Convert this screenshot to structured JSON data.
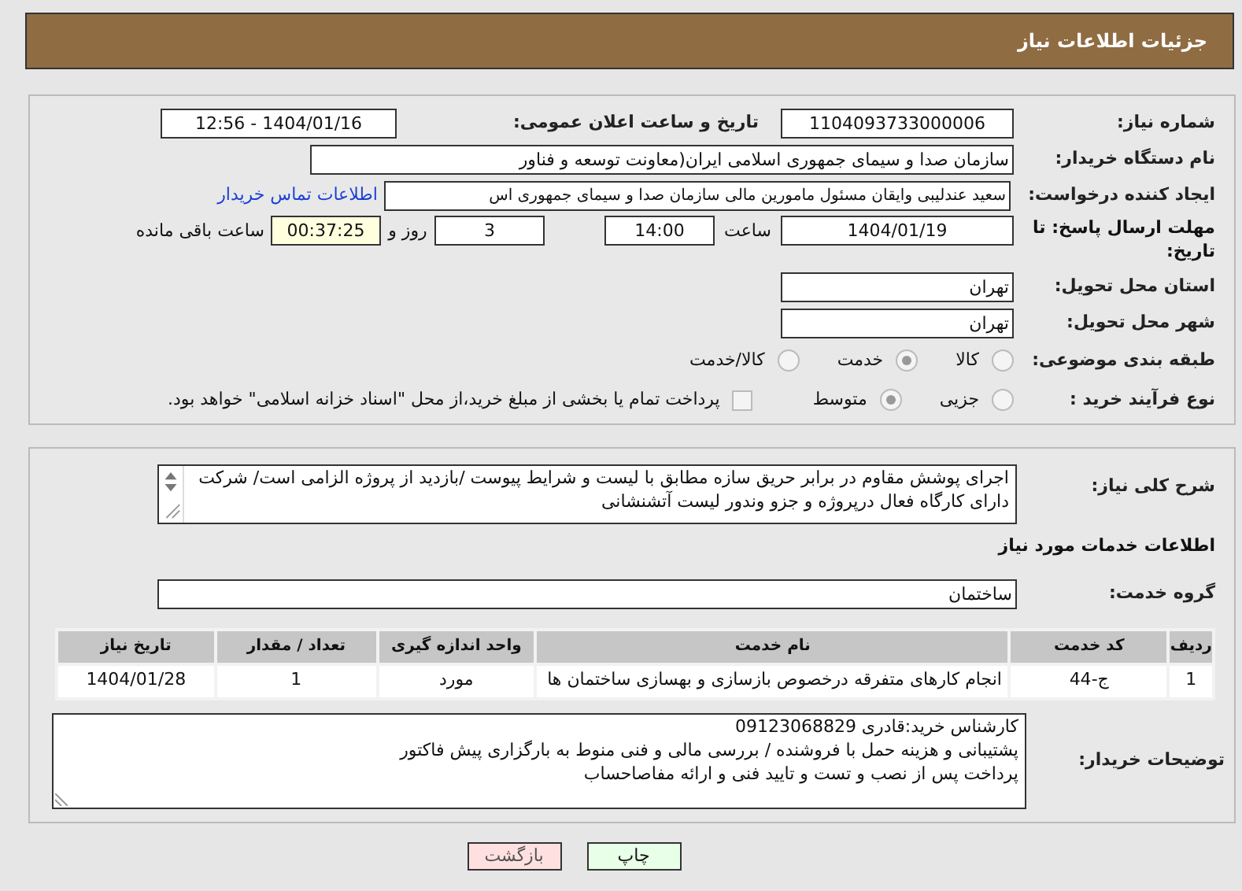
{
  "header": {
    "title": "جزئیات اطلاعات نیاز"
  },
  "need_number": {
    "label": "شماره نیاز:",
    "value": "1104093733000006"
  },
  "announce": {
    "label": "تاریخ و ساعت اعلان عمومی:",
    "value": "1404/01/16 - 12:56"
  },
  "buyer_org": {
    "label": "نام دستگاه خریدار:",
    "value": "سازمان صدا و سیمای جمهوری اسلامی ایران(معاونت توسعه و فناور"
  },
  "requester": {
    "label": "ایجاد کننده درخواست:",
    "value": "سعید عندلیبی وایقان مسئول مامورین مالی  سازمان صدا و سیمای جمهوری اس",
    "link": "اطلاعات تماس خریدار"
  },
  "deadline": {
    "label": "مهلت ارسال پاسخ: تا تاریخ:",
    "date": "1404/01/19",
    "time_label": "ساعت",
    "time": "14:00",
    "days": "3",
    "days_label": "روز و",
    "remaining": "00:37:25",
    "remaining_label": "ساعت باقی مانده"
  },
  "province": {
    "label": "استان محل تحویل:",
    "value": "تهران"
  },
  "city": {
    "label": "شهر محل تحویل:",
    "value": "تهران"
  },
  "category": {
    "label": "طبقه بندی موضوعی:",
    "options": [
      {
        "label": "کالا",
        "selected": false
      },
      {
        "label": "خدمت",
        "selected": true
      },
      {
        "label": "کالا/خدمت",
        "selected": false
      }
    ]
  },
  "process": {
    "label": "نوع فرآیند خرید :",
    "options": [
      {
        "label": "جزیی",
        "selected": false
      },
      {
        "label": "متوسط",
        "selected": true
      }
    ],
    "payment": {
      "label": "پرداخت تمام یا بخشی از مبلغ خرید،از محل \"اسناد خزانه اسلامی\" خواهد بود.",
      "checked": false
    }
  },
  "description": {
    "label": "شرح کلی نیاز:",
    "text": "اجرای پوشش مقاوم در برابر حریق سازه مطابق با لیست و شرایط پیوست /بازدید از پروژه الزامی است/ شرکت دارای کارگاه فعال درپروژه و جزو وندور لیست آتشنشانی"
  },
  "services_title": "اطلاعات خدمات مورد نیاز",
  "service_group": {
    "label": "گروه خدمت:",
    "value": "ساختمان"
  },
  "table": {
    "columns": [
      "ردیف",
      "کد خدمت",
      "نام خدمت",
      "واحد اندازه گیری",
      "تعداد / مقدار",
      "تاریخ نیاز"
    ],
    "rows": [
      [
        "1",
        "ج-44",
        "انجام کارهای متفرقه درخصوص بازسازی و بهسازی ساختمان ها",
        "مورد",
        "1",
        "1404/01/28"
      ]
    ]
  },
  "buyer_notes": {
    "label": "توضیحات خریدار:",
    "lines": [
      "کارشناس خرید:قادری 09123068829",
      "پشتیبانی و هزینه حمل با فروشنده / بررسی مالی و فنی منوط به بارگزاری پیش فاکتور",
      "پرداخت پس از نصب و تست و تایید فنی و ارائه مفاصاحساب"
    ]
  },
  "buttons": [
    {
      "label": "چاپ",
      "kind": "print"
    },
    {
      "label": "بازگشت",
      "kind": "back"
    }
  ]
}
